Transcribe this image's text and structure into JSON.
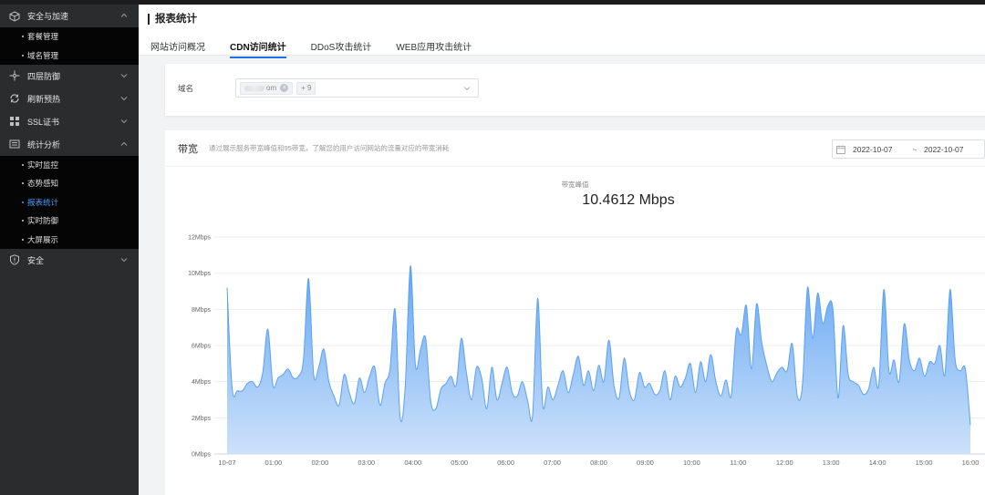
{
  "sidebar": {
    "groups": [
      {
        "label": "安全与加速",
        "icon": "cube-icon",
        "expanded": true,
        "items": [
          {
            "label": "套餐管理"
          },
          {
            "label": "域名管理"
          }
        ]
      },
      {
        "label": "四层防御",
        "icon": "network-icon",
        "expanded": false
      },
      {
        "label": "刷新预热",
        "icon": "refresh-icon",
        "expanded": false
      },
      {
        "label": "SSL证书",
        "icon": "grid-icon",
        "expanded": false
      },
      {
        "label": "统计分析",
        "icon": "list-icon",
        "expanded": true,
        "items": [
          {
            "label": "实时监控"
          },
          {
            "label": "态势感知"
          },
          {
            "label": "报表统计",
            "active": true
          },
          {
            "label": "实时防御"
          },
          {
            "label": "大屏展示"
          }
        ]
      },
      {
        "label": "安全",
        "icon": "shield-icon",
        "expanded": false
      }
    ]
  },
  "header": {
    "title": "报表统计",
    "tabs": [
      {
        "label": "网站访问概况"
      },
      {
        "label": "CDN访问统计",
        "active": true
      },
      {
        "label": "DDoS攻击统计"
      },
      {
        "label": "WEB应用攻击统计"
      }
    ]
  },
  "filter": {
    "domain_label": "域名",
    "domain_tag": "om",
    "more_tag": "+ 9"
  },
  "bandwidth": {
    "title": "带宽",
    "description": "通过展示服务带宽峰值和95带宽，了解您的用户访问网站的流量对应的带宽消耗",
    "start_date": "2022-10-07",
    "separator": "~",
    "end_date": "2022-10-07",
    "metric_label": "带宽峰值",
    "metric_value": "10.4612 Mbps"
  },
  "colors": {
    "accent": "#1f6fe6",
    "series_line": "#5aa1f2",
    "active_nav": "#4a9bff"
  },
  "chart_data": {
    "type": "area",
    "ylim": [
      0,
      12
    ],
    "yticks": [
      "0Mbps",
      "2Mbps",
      "4Mbps",
      "6Mbps",
      "8Mbps",
      "10Mbps",
      "12Mbps"
    ],
    "yvalues": [
      0,
      2,
      4,
      6,
      8,
      10,
      12
    ],
    "xticks": [
      "10-07",
      "01:00",
      "02:00",
      "03:00",
      "04:00",
      "05:00",
      "06:00",
      "07:00",
      "08:00",
      "09:00",
      "10:00",
      "11:00",
      "12:00",
      "13:00",
      "14:00",
      "15:00",
      "16:00"
    ],
    "grid": true,
    "series": [
      {
        "values": [
          9.2,
          3.6,
          3.5,
          3.5,
          3.9,
          4.0,
          3.7,
          4.5,
          6.9,
          3.8,
          4.2,
          4.4,
          4.7,
          4.2,
          4.3,
          5.2,
          9.7,
          4.4,
          4.8,
          5.8,
          4.0,
          3.2,
          2.7,
          4.4,
          3.4,
          2.8,
          4.2,
          3.4,
          4.3,
          4.8,
          2.7,
          3.9,
          4.7,
          8.0,
          2.0,
          3.8,
          10.4,
          4.9,
          5.8,
          6.4,
          2.9,
          2.5,
          3.6,
          3.9,
          4.3,
          3.8,
          6.4,
          4.5,
          3.0,
          4.8,
          4.2,
          2.5,
          4.8,
          3.0,
          3.9,
          4.8,
          3.4,
          3.2,
          4.0,
          3.0,
          2.1,
          8.6,
          2.7,
          3.7,
          3.0,
          3.8,
          4.6,
          3.4,
          4.4,
          5.4,
          3.8,
          4.6,
          3.5,
          4.9,
          4.0,
          6.3,
          3.8,
          3.1,
          5.3,
          3.5,
          3.0,
          4.5,
          3.7,
          3.9,
          3.3,
          3.5,
          4.6,
          3.0,
          4.3,
          3.7,
          4.2,
          5.0,
          3.4,
          5.1,
          4.0,
          5.5,
          4.0,
          3.2,
          4.1,
          3.2,
          6.8,
          6.6,
          8.2,
          4.7,
          8.3,
          6.2,
          4.9,
          4.0,
          4.5,
          4.8,
          4.6,
          6.1,
          3.2,
          3.8,
          9.2,
          6.4,
          8.9,
          7.2,
          8.2,
          8.0,
          3.1,
          7.1,
          4.4,
          4.0,
          3.8,
          3.3,
          3.6,
          4.8,
          3.8,
          9.1,
          4.6,
          5.2,
          4.0,
          7.2,
          5.2,
          4.6,
          5.3,
          4.3,
          5.1,
          5.0,
          6.0,
          4.4,
          9.1,
          5.2,
          4.6,
          4.7,
          1.6
        ]
      }
    ]
  }
}
